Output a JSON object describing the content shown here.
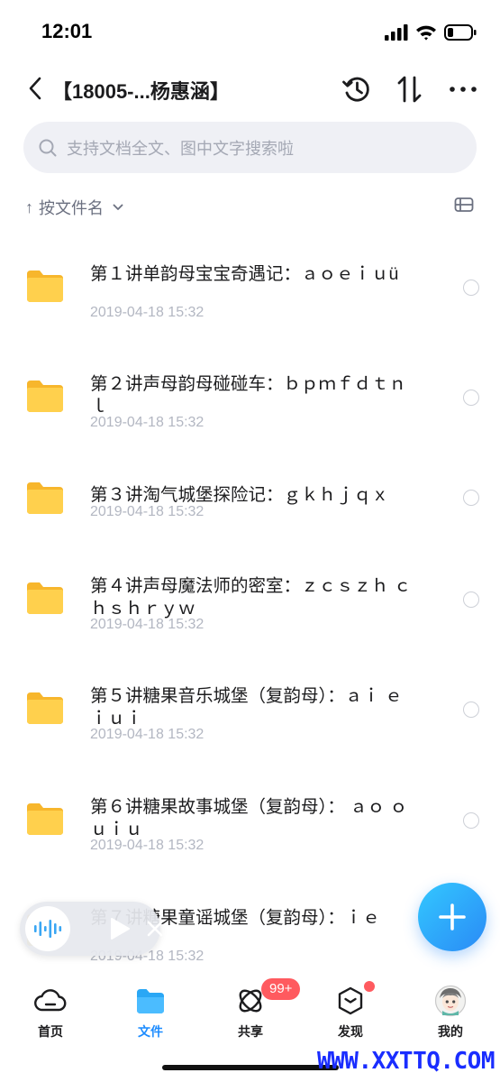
{
  "status": {
    "time": "12:01"
  },
  "header": {
    "title": "【18005-...杨惠涵】",
    "actions": [
      {
        "icon": "history-icon"
      },
      {
        "icon": "sort-arrows-icon"
      },
      {
        "icon": "more-icon"
      }
    ]
  },
  "search": {
    "placeholder": "支持文档全文、图中文字搜索啦"
  },
  "sort": {
    "label": "按文件名",
    "arrow": "↑"
  },
  "files": [
    {
      "name": "第１讲单韵母宝宝奇遇记：ａｏｅｉｕü",
      "date": "2019-04-18 15:32"
    },
    {
      "name": "第２讲声母韵母碰碰车：ｂｐｍｆｄｔｎｌ",
      "date": "2019-04-18 15:32"
    },
    {
      "name": "第３讲淘气城堡探险记：ｇｋｈｊｑｘ",
      "date": "2019-04-18 15:32"
    },
    {
      "name": "第４讲声母魔法师的密室：ｚｃｓｚｈ ｃｈｓｈｒｙｗ",
      "date": "2019-04-18 15:32"
    },
    {
      "name": "第５讲糖果音乐城堡（复韵母）：ａｉ ｅｉｕｉ",
      "date": "2019-04-18 15:32"
    },
    {
      "name": "第６讲糖果故事城堡（复韵母）： ａｏ ｏｕｉｕ",
      "date": "2019-04-18 15:32"
    },
    {
      "name": "第７讲糖果童谣城堡（复韵母）：ｉｅ",
      "date": "2019-04-18 15:32"
    }
  ],
  "tabs": [
    {
      "label": "首页",
      "icon": "cloud-home-icon"
    },
    {
      "label": "文件",
      "icon": "folder-tab-icon"
    },
    {
      "label": "共享",
      "icon": "share-orbit-icon"
    },
    {
      "label": "发现",
      "icon": "discover-box-icon"
    },
    {
      "label": "我的",
      "icon": "avatar-icon"
    }
  ],
  "share_badge": "99+",
  "watermark": "WWW.XXTTQ.COM",
  "colors": {
    "accent": "#1d8cff",
    "folder": "#ffc83d",
    "badge": "#ff5a5f",
    "watermark": "#1a2dff"
  }
}
